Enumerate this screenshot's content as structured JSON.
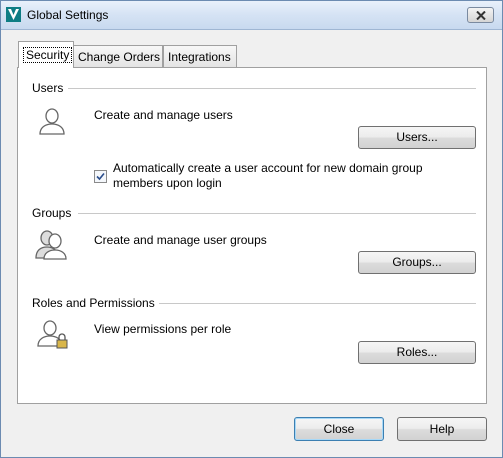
{
  "window": {
    "title": "Global Settings"
  },
  "tabs": [
    {
      "label": "Security",
      "active": true
    },
    {
      "label": "Change Orders",
      "active": false
    },
    {
      "label": "Integrations",
      "active": false
    }
  ],
  "users": {
    "heading": "Users",
    "description": "Create and manage users",
    "button": "Users...",
    "checkbox_label": "Automatically create a user account for new domain group members upon login",
    "checkbox_checked": true
  },
  "groups": {
    "heading": "Groups",
    "description": "Create and manage user groups",
    "button": "Groups..."
  },
  "roles": {
    "heading": "Roles and Permissions",
    "description": "View permissions per role",
    "button": "Roles..."
  },
  "footer": {
    "close_label": "Close",
    "help_label": "Help"
  },
  "colors": {
    "titlebar": "#d5e3f4",
    "panel": "#ffffff",
    "window_bg": "#f0f0f0",
    "app_icon": "#0e7d84"
  },
  "icons": [
    "app-icon",
    "close-icon",
    "user-icon",
    "group-icon",
    "user-lock-icon",
    "checkmark-icon"
  ]
}
